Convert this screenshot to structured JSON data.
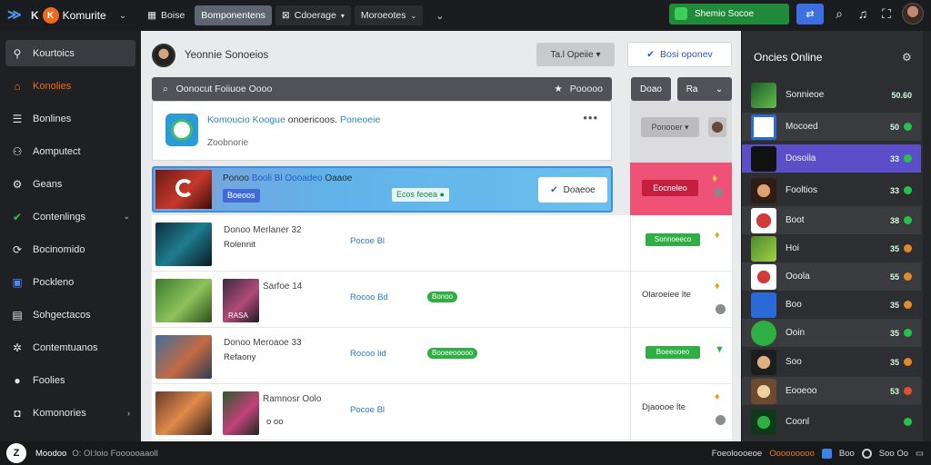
{
  "topbar": {
    "k_label": "K",
    "app_name": "Komurite",
    "nav": [
      {
        "label": "Boise",
        "active": false,
        "dropdown": false
      },
      {
        "label": "Bomponentens",
        "active": true,
        "dropdown": false
      },
      {
        "label": "Cdoerage",
        "active": false,
        "dropdown": true
      },
      {
        "label": "Moroeotes",
        "active": false,
        "dropdown": true
      }
    ],
    "green_button": "Shemio Socoe",
    "colors": {
      "accent_green": "#1f8a3a",
      "accent_blue": "#3d6fe0",
      "logo_orange": "#f06a1c"
    }
  },
  "sidebar": {
    "items": [
      {
        "label": "Kourtoics",
        "icon": "user-search-icon",
        "active": true
      },
      {
        "label": "Konolies",
        "icon": "home-icon",
        "active": false
      },
      {
        "label": "Bonlines",
        "icon": "list-icon",
        "active": false
      },
      {
        "label": "Aomputect",
        "icon": "group-icon",
        "active": false
      },
      {
        "label": "Geans",
        "icon": "gamepad-icon",
        "active": false
      },
      {
        "label": "Contenlings",
        "icon": "shield-check-icon",
        "active": false
      },
      {
        "label": "Bocinomido",
        "icon": "refresh-icon",
        "active": false
      },
      {
        "label": "Pockleno",
        "icon": "calendar-icon",
        "active": false
      },
      {
        "label": "Sohgectacos",
        "icon": "document-icon",
        "active": false
      },
      {
        "label": "Contemtuanos",
        "icon": "settings-icon",
        "active": false
      },
      {
        "label": "Foolies",
        "icon": "chat-icon",
        "active": false
      },
      {
        "label": "Komonories",
        "icon": "window-icon",
        "active": false
      }
    ]
  },
  "main": {
    "header_title": "Yeonnie Sonoeios",
    "header_select": "Ta.l Opeiie",
    "header_button": "Bosi oponev",
    "search_text": "Oonocut Foiiuoe Oooo",
    "search_right": "Pooooo",
    "filter1": "Doao",
    "filter2": "Ra",
    "card": {
      "title_prefix": "Komoucio Koogue",
      "title_mid": "onoericoos.",
      "title_link": "Poneoeie",
      "subtitle": "Zoobnorie"
    },
    "right_select": "Ponooer",
    "banner": {
      "title_a": "Ponoo",
      "title_b": "Booli Bl",
      "title_c": "Oooadeo",
      "title_d": "Oaaoe",
      "tag": "Boeoos",
      "status": "Ecos feoea",
      "button": "Doaeoe"
    },
    "pink_button": "Eocneleo",
    "rows": [
      {
        "title": "Donoo Merlaner 32",
        "sub": "Rolennit",
        "link": "Pocoe Bl",
        "pill": "",
        "status_button": "Sonnoeeco",
        "status_text": ""
      },
      {
        "title": "Sarfoe 14",
        "sub": "RASA",
        "link": "Rocoo Bd",
        "pill": "Bonoo",
        "status_button": "",
        "status_text": "Olaroeiee lte"
      },
      {
        "title": "Donoo Meroaoe 33",
        "sub": "Refaony",
        "link": "Rocoo lid",
        "pill": "Booeeooooo",
        "status_button": "Boeeooeo",
        "status_text": ""
      },
      {
        "title": "Ramnosr Oolo",
        "sub": "o oo",
        "link": "Pocoe Bl",
        "pill": "",
        "status_button": "",
        "status_text": "Djaoooe lte"
      }
    ]
  },
  "online": {
    "title": "Oncies Online",
    "users": [
      {
        "name": "Sonnieoe",
        "status": "50.60"
      },
      {
        "name": "Mocoed",
        "status": "50"
      },
      {
        "name": "Dosoila",
        "status": "33"
      },
      {
        "name": "Fooltios",
        "status": "33"
      },
      {
        "name": "Boot",
        "status": "38"
      },
      {
        "name": "Hoi",
        "status": "35"
      },
      {
        "name": "Ooola",
        "status": "55"
      },
      {
        "name": "Boo",
        "status": "35"
      },
      {
        "name": "Ooin",
        "status": "35"
      },
      {
        "name": "Soo",
        "status": "35"
      },
      {
        "name": "Eooeoo",
        "status": "53"
      },
      {
        "name": "Coonl",
        "status": ""
      }
    ]
  },
  "footer": {
    "badge": "Z",
    "name": "Moodoo",
    "subtitle": "O: Ol:loio Foooooaaoll",
    "right_a": "Foeoloooeoe",
    "right_b": "Ooooooooo",
    "right_c": "Boo",
    "right_d": "Soo Oo"
  }
}
